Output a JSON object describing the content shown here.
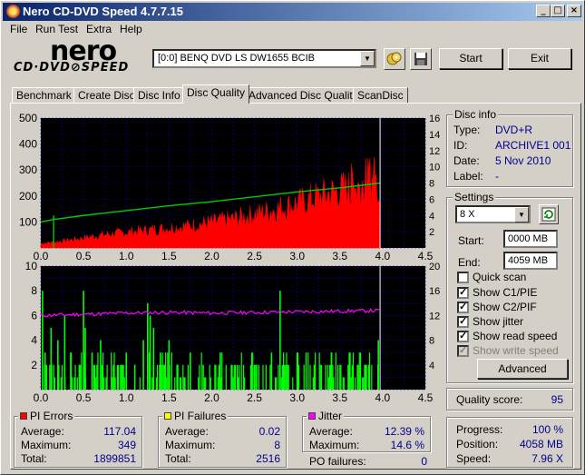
{
  "window": {
    "title": "Nero CD-DVD Speed 4.7.7.15"
  },
  "titlebar_buttons": {
    "minimize": "_",
    "maximize": "□",
    "close": "×"
  },
  "menu": {
    "items": [
      "File",
      "Run Test",
      "Extra",
      "Help"
    ]
  },
  "logo": {
    "line1": "nero",
    "line2": "CD·DVD⊘SPEED"
  },
  "drive": {
    "selected": "[0:0]  BENQ DVD LS DW1655 BCIB"
  },
  "buttons": {
    "start": "Start",
    "exit": "Exit",
    "advanced": "Advanced"
  },
  "tabs": [
    "Benchmark",
    "Create Disc",
    "Disc Info",
    "Disc Quality",
    "Advanced Disc Quality",
    "ScanDisc"
  ],
  "active_tab": "Disc Quality",
  "disc_info": {
    "title": "Disc info",
    "type_label": "Type:",
    "type": "DVD+R",
    "id_label": "ID:",
    "id": "ARCHIVE1 001",
    "date_label": "Date:",
    "date": "5 Nov 2010",
    "label_label": "Label:",
    "label": "-"
  },
  "settings": {
    "title": "Settings",
    "speed": "8 X",
    "start_label": "Start:",
    "start": "0000 MB",
    "end_label": "End:",
    "end": "4059 MB",
    "checkboxes": [
      {
        "label": "Quick scan",
        "checked": false,
        "disabled": false
      },
      {
        "label": "Show C1/PIE",
        "checked": true,
        "disabled": false
      },
      {
        "label": "Show C2/PIF",
        "checked": true,
        "disabled": false
      },
      {
        "label": "Show jitter",
        "checked": true,
        "disabled": false
      },
      {
        "label": "Show read speed",
        "checked": true,
        "disabled": false
      },
      {
        "label": "Show write speed",
        "checked": true,
        "disabled": true
      }
    ]
  },
  "quality": {
    "label": "Quality score:",
    "value": "95"
  },
  "progress": {
    "progress_label": "Progress:",
    "progress": "100 %",
    "position_label": "Position:",
    "position": "4058 MB",
    "speed_label": "Speed:",
    "speed": "7.96 X"
  },
  "pi_errors": {
    "title": "PI Errors",
    "average_label": "Average:",
    "average": "117.04",
    "maximum_label": "Maximum:",
    "maximum": "349",
    "total_label": "Total:",
    "total": "1899851"
  },
  "pi_failures": {
    "title": "PI Failures",
    "average_label": "Average:",
    "average": "0.02",
    "maximum_label": "Maximum:",
    "maximum": "8",
    "total_label": "Total:",
    "total": "2516"
  },
  "jitter": {
    "title": "Jitter",
    "average_label": "Average:",
    "average": "12.39 %",
    "maximum_label": "Maximum:",
    "maximum": "14.6 %",
    "po_label": "PO failures:",
    "po": "0"
  },
  "colors": {
    "pie": "#ff0000",
    "pif": "#00ff00",
    "jitter": "#ff00ff",
    "speed": "#00cc00",
    "chart_bg": "#000000",
    "grid": "#0000aa",
    "value": "#00008b"
  },
  "chart_data": [
    {
      "type": "area",
      "title": "PI Errors / read speed",
      "x_ticks": [
        "0.0",
        "0.5",
        "1.0",
        "1.5",
        "2.0",
        "2.5",
        "3.0",
        "3.5",
        "4.0",
        "4.5"
      ],
      "y_left_ticks": [
        "100",
        "200",
        "300",
        "400",
        "500"
      ],
      "y_right_ticks": [
        "2",
        "4",
        "6",
        "8",
        "10",
        "12",
        "14",
        "16"
      ],
      "xlim": [
        0,
        4.5
      ],
      "ylim": [
        0,
        500
      ],
      "y2lim": [
        0,
        16
      ],
      "series": [
        {
          "name": "PIE",
          "x": [
            0,
            0.25,
            0.5,
            0.75,
            1.0,
            1.25,
            1.5,
            1.75,
            2.0,
            2.25,
            2.5,
            2.75,
            3.0,
            3.25,
            3.5,
            3.75,
            3.97
          ],
          "values": [
            20,
            30,
            45,
            60,
            70,
            80,
            90,
            100,
            115,
            130,
            150,
            175,
            200,
            230,
            260,
            280,
            300
          ],
          "peak": 349
        },
        {
          "name": "Read speed",
          "x": [
            0,
            0.15,
            0.5,
            1.0,
            1.5,
            2.0,
            2.5,
            3.0,
            3.5,
            3.97
          ],
          "values": [
            3.2,
            3.5,
            4.0,
            4.6,
            5.2,
            5.7,
            6.3,
            6.9,
            7.4,
            8.0
          ]
        }
      ]
    },
    {
      "type": "bar",
      "title": "PI Failures / jitter",
      "x_ticks": [
        "0.0",
        "0.5",
        "1.0",
        "1.5",
        "2.0",
        "2.5",
        "3.0",
        "3.5",
        "4.0",
        "4.5"
      ],
      "y_left_ticks": [
        "2",
        "4",
        "6",
        "8",
        "10"
      ],
      "y_right_ticks": [
        "4",
        "8",
        "12",
        "16",
        "20"
      ],
      "xlim": [
        0,
        4.5
      ],
      "ylim": [
        0,
        10
      ],
      "y2lim": [
        0,
        20
      ],
      "series": [
        {
          "name": "PIF",
          "x": [
            0.02,
            0.05,
            0.12,
            0.2,
            0.28,
            0.35,
            0.45,
            0.5,
            0.52,
            0.6,
            0.7,
            0.85,
            1.0,
            1.1,
            1.2,
            1.25,
            1.28,
            1.32,
            1.4,
            1.5,
            1.6,
            1.75,
            1.9,
            2.1,
            2.3,
            2.5,
            2.7,
            2.8,
            2.85,
            3.0,
            3.2,
            3.4,
            3.6,
            3.8,
            3.95
          ],
          "values": [
            8,
            3,
            5,
            4,
            6,
            3,
            2,
            8,
            5,
            3,
            4,
            2,
            3,
            2,
            4,
            7,
            6,
            5,
            3,
            4,
            2,
            3,
            2,
            3,
            2,
            2,
            3,
            8,
            2,
            3,
            2,
            3,
            2,
            2,
            4
          ]
        },
        {
          "name": "Jitter",
          "x": [
            0,
            0.5,
            1.0,
            1.5,
            2.0,
            2.5,
            3.0,
            3.5,
            3.97
          ],
          "values": [
            12.0,
            12.2,
            12.4,
            12.5,
            12.4,
            12.5,
            12.6,
            12.7,
            12.8
          ]
        }
      ]
    }
  ]
}
